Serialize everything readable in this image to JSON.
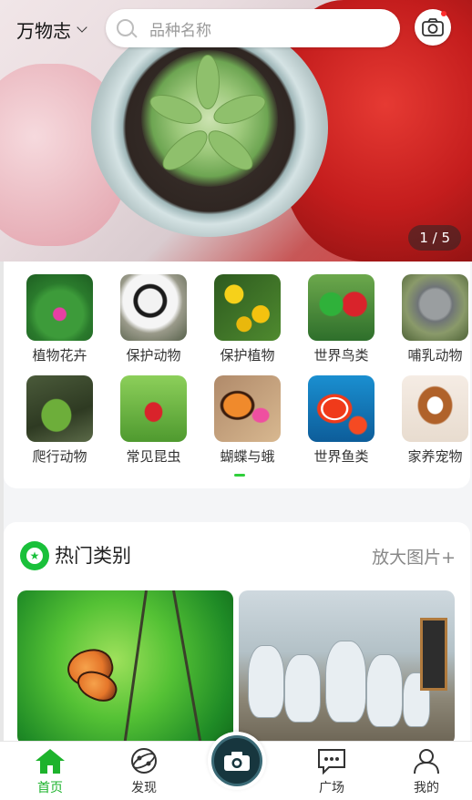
{
  "header": {
    "city": "万物志",
    "search_placeholder": "品种名称"
  },
  "banner": {
    "counter": "1 / 5"
  },
  "categories": [
    {
      "label": "植物花卉",
      "icon": "lotus-icon"
    },
    {
      "label": "保护动物",
      "icon": "panda-icon"
    },
    {
      "label": "保护植物",
      "icon": "yellow-flower-icon"
    },
    {
      "label": "世界鸟类",
      "icon": "parrot-icon"
    },
    {
      "label": "哺乳动物",
      "icon": "koala-icon"
    },
    {
      "label": "爬行动物",
      "icon": "iguana-icon"
    },
    {
      "label": "常见昆虫",
      "icon": "insect-icon"
    },
    {
      "label": "蝴蝶与蛾",
      "icon": "butterfly-icon"
    },
    {
      "label": "世界鱼类",
      "icon": "clownfish-icon"
    },
    {
      "label": "家养宠物",
      "icon": "dog-icon"
    }
  ],
  "hot": {
    "title": "热门类别",
    "more": "放大图片+"
  },
  "tabs": [
    {
      "label": "首页",
      "active": true
    },
    {
      "label": "发现",
      "active": false
    },
    {
      "label": "广场",
      "active": false
    },
    {
      "label": "我的",
      "active": false
    }
  ],
  "colors": {
    "accent": "#1db32c",
    "notification_dot": "#ff2d2d"
  }
}
